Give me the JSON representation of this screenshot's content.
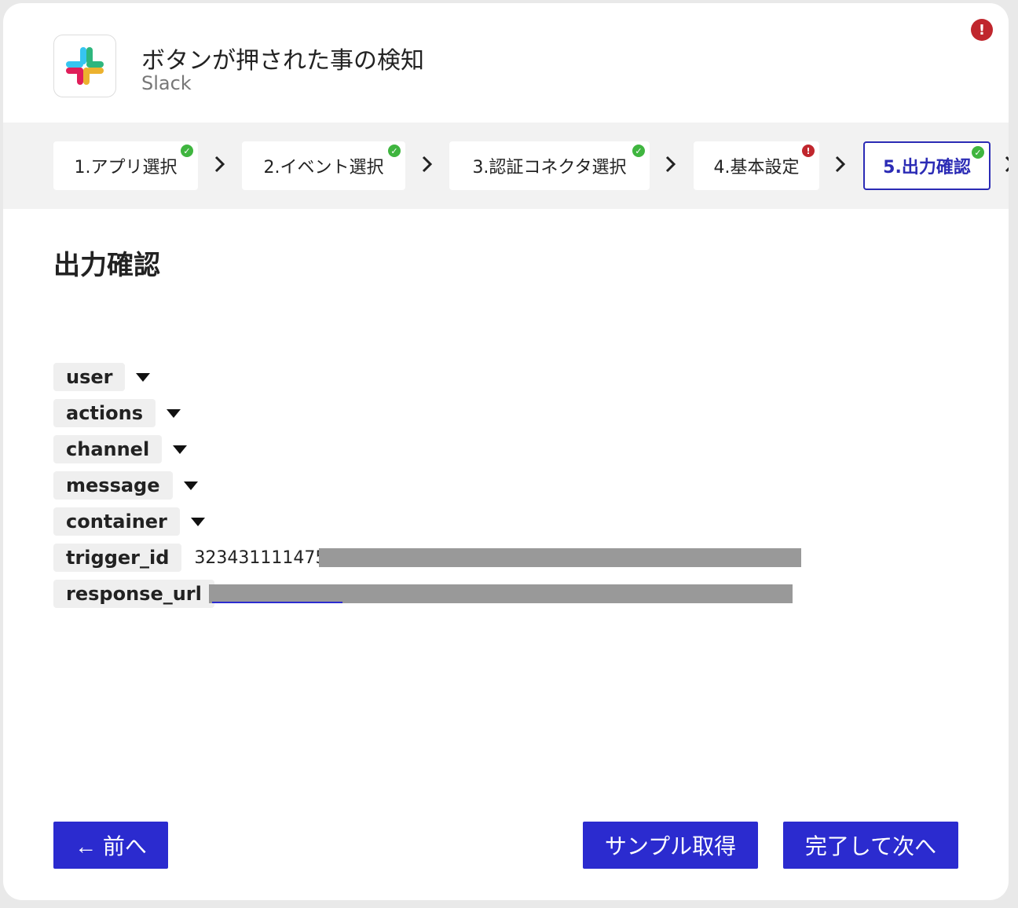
{
  "header": {
    "title": "ボタンが押された事の検知",
    "app_name": "Slack",
    "app_icon": "slack-logo",
    "alert_icon": "!"
  },
  "steps": [
    {
      "label": "1.アプリ選択",
      "status": "ok"
    },
    {
      "label": "2.イベント選択",
      "status": "ok"
    },
    {
      "label": "3.認証コネクタ選択",
      "status": "ok"
    },
    {
      "label": "4.基本設定",
      "status": "error"
    },
    {
      "label": "5.出力確認",
      "status": "ok",
      "active": true
    }
  ],
  "section": {
    "title": "出力確認"
  },
  "fields": [
    {
      "key": "user",
      "expandable": true
    },
    {
      "key": "actions",
      "expandable": true
    },
    {
      "key": "channel",
      "expandable": true
    },
    {
      "key": "message",
      "expandable": true
    },
    {
      "key": "container",
      "expandable": true
    },
    {
      "key": "trigger_id",
      "value": "3234311114755"
    },
    {
      "key": "response_url",
      "value": ""
    }
  ],
  "buttons": {
    "prev": "← 前へ",
    "sample": "サンプル取得",
    "next": "完了して次へ"
  },
  "colors": {
    "primary": "#2b2bcf",
    "ok": "#3fb53f",
    "error": "#c0262d"
  }
}
